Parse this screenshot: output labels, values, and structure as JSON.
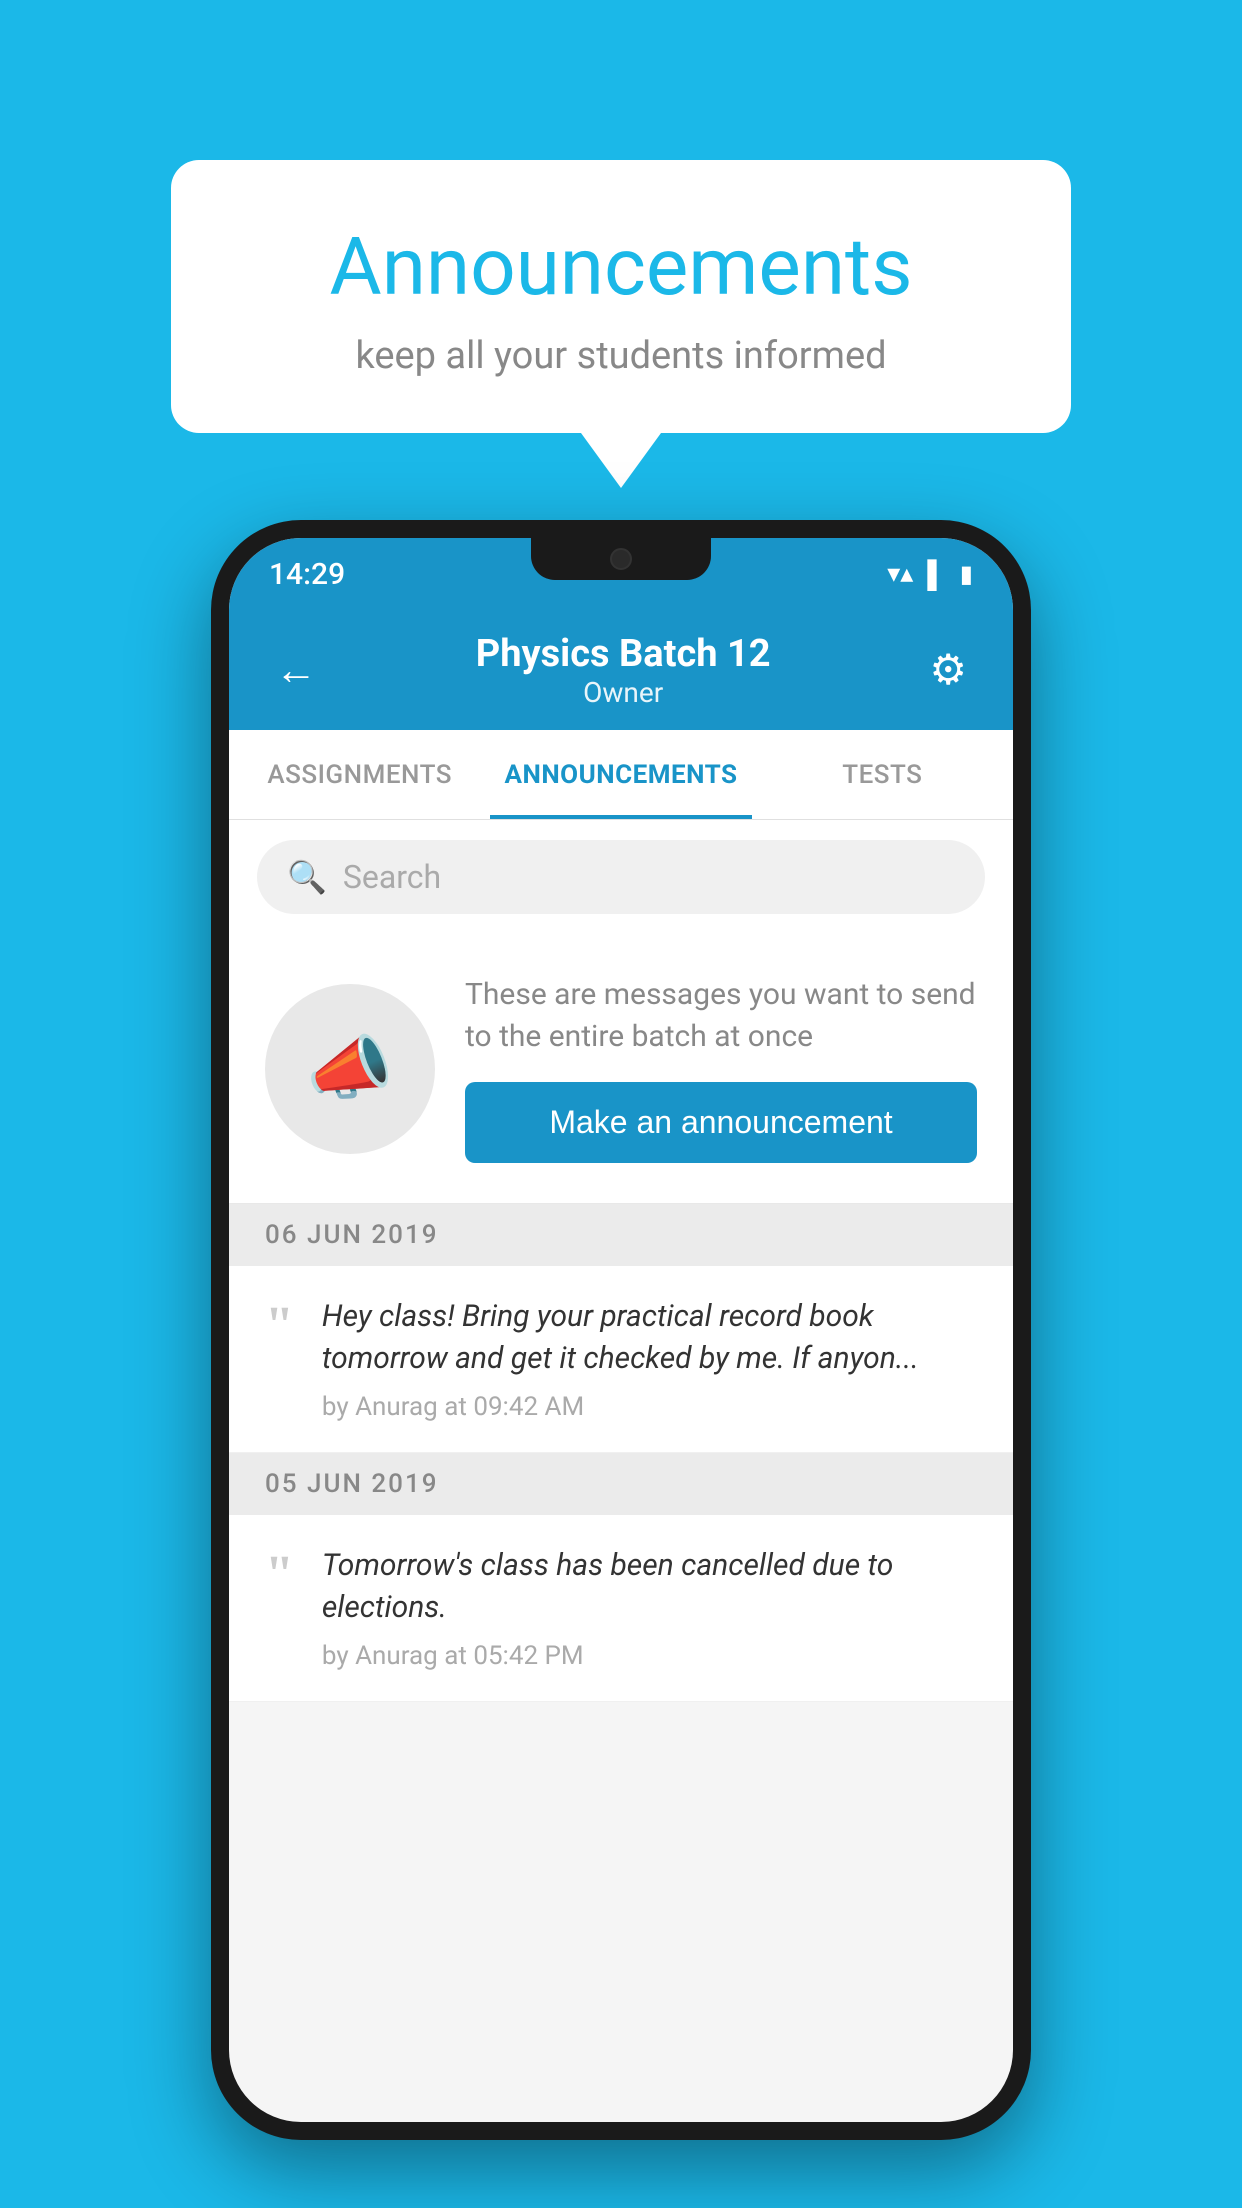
{
  "background_color": "#1bb8e8",
  "speech_bubble": {
    "title": "Announcements",
    "subtitle": "keep all your students informed"
  },
  "phone": {
    "status_bar": {
      "time": "14:29"
    },
    "app_bar": {
      "title": "Physics Batch 12",
      "subtitle": "Owner",
      "back_icon": "←",
      "gear_icon": "⚙"
    },
    "tabs": [
      {
        "label": "ASSIGNMENTS",
        "active": false
      },
      {
        "label": "ANNOUNCEMENTS",
        "active": true
      },
      {
        "label": "TESTS",
        "active": false
      }
    ],
    "search": {
      "placeholder": "Search"
    },
    "announcement_prompt": {
      "description": "These are messages you want to send to the entire batch at once",
      "button_label": "Make an announcement"
    },
    "announcements": [
      {
        "date": "06  JUN  2019",
        "text": "Hey class! Bring your practical record book tomorrow and get it checked by me. If anyon...",
        "meta": "by Anurag at 09:42 AM"
      },
      {
        "date": "05  JUN  2019",
        "text": "Tomorrow's class has been cancelled due to elections.",
        "meta": "by Anurag at 05:42 PM"
      }
    ]
  }
}
